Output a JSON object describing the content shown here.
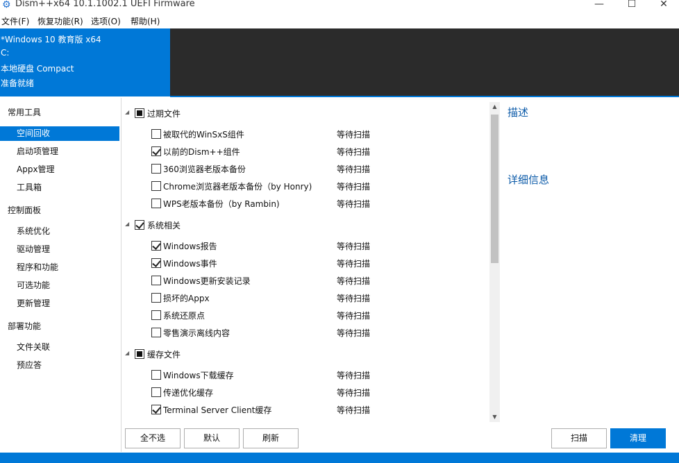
{
  "window": {
    "title": "Dism++x64 10.1.1002.1 UEFI Firmware",
    "minimize": "—",
    "maximize": "☐",
    "close": "✕"
  },
  "menu": [
    "文件(F)",
    "恢复功能(R)",
    "选项(O)",
    "帮助(H)"
  ],
  "info": {
    "os": "*Windows 10 教育版 x64",
    "drive": "C:",
    "disk": "本地硬盘 Compact",
    "status": "准备就绪"
  },
  "sidebar": {
    "groups": [
      {
        "label": "常用工具",
        "items": [
          "空间回收",
          "启动项管理",
          "Appx管理",
          "工具箱"
        ]
      },
      {
        "label": "控制面板",
        "items": [
          "系统优化",
          "驱动管理",
          "程序和功能",
          "可选功能",
          "更新管理"
        ]
      },
      {
        "label": "部署功能",
        "items": [
          "文件关联",
          "预应答"
        ]
      }
    ],
    "active_item": "空间回收"
  },
  "list": {
    "groups": [
      {
        "label": "过期文件",
        "state": "partial",
        "items": [
          {
            "label": "被取代的WinSxS组件",
            "checked": false,
            "status": "等待扫描"
          },
          {
            "label": "以前的Dism++组件",
            "checked": true,
            "status": "等待扫描"
          },
          {
            "label": "360浏览器老版本备份",
            "checked": false,
            "status": "等待扫描"
          },
          {
            "label": "Chrome浏览器老版本备份（by Honry)",
            "checked": false,
            "status": "等待扫描"
          },
          {
            "label": "WPS老版本备份（by Rambin)",
            "checked": false,
            "status": "等待扫描"
          }
        ]
      },
      {
        "label": "系统相关",
        "state": "checked",
        "items": [
          {
            "label": "Windows报告",
            "checked": true,
            "status": "等待扫描"
          },
          {
            "label": "Windows事件",
            "checked": true,
            "status": "等待扫描"
          },
          {
            "label": "Windows更新安装记录",
            "checked": false,
            "status": "等待扫描"
          },
          {
            "label": "损坏的Appx",
            "checked": false,
            "status": "等待扫描"
          },
          {
            "label": "系统还原点",
            "checked": false,
            "status": "等待扫描"
          },
          {
            "label": "零售演示离线内容",
            "checked": false,
            "status": "等待扫描"
          }
        ]
      },
      {
        "label": "缓存文件",
        "state": "partial",
        "items": [
          {
            "label": "Windows下载缓存",
            "checked": false,
            "status": "等待扫描"
          },
          {
            "label": "传递优化缓存",
            "checked": false,
            "status": "等待扫描"
          },
          {
            "label": "Terminal Server Client缓存",
            "checked": true,
            "status": "等待扫描"
          }
        ]
      }
    ]
  },
  "description": {
    "heading": "描述",
    "details_heading": "详细信息"
  },
  "buttons": {
    "select_none": "全不选",
    "default": "默认",
    "refresh": "刷新",
    "scan": "扫描",
    "clean": "清理"
  },
  "icons": {
    "app": "gear-icon",
    "group_toggle": "collapse-triangle-icon",
    "scroll_up": "scroll-up-arrow-icon",
    "scroll_down": "scroll-down-arrow-icon"
  },
  "colors": {
    "accent": "#0078d7",
    "dark_panel": "#2b2b2b",
    "heading_text": "#0b5aa8"
  }
}
